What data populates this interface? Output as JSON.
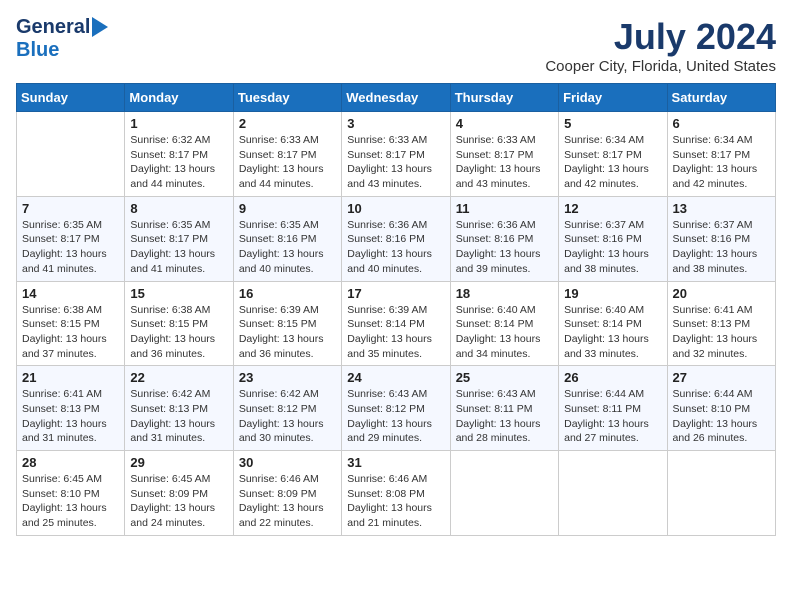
{
  "header": {
    "logo_general": "General",
    "logo_blue": "Blue",
    "month_year": "July 2024",
    "location": "Cooper City, Florida, United States"
  },
  "days_of_week": [
    "Sunday",
    "Monday",
    "Tuesday",
    "Wednesday",
    "Thursday",
    "Friday",
    "Saturday"
  ],
  "weeks": [
    [
      {
        "day": "",
        "sunrise": "",
        "sunset": "",
        "daylight": ""
      },
      {
        "day": "1",
        "sunrise": "Sunrise: 6:32 AM",
        "sunset": "Sunset: 8:17 PM",
        "daylight": "Daylight: 13 hours and 44 minutes."
      },
      {
        "day": "2",
        "sunrise": "Sunrise: 6:33 AM",
        "sunset": "Sunset: 8:17 PM",
        "daylight": "Daylight: 13 hours and 44 minutes."
      },
      {
        "day": "3",
        "sunrise": "Sunrise: 6:33 AM",
        "sunset": "Sunset: 8:17 PM",
        "daylight": "Daylight: 13 hours and 43 minutes."
      },
      {
        "day": "4",
        "sunrise": "Sunrise: 6:33 AM",
        "sunset": "Sunset: 8:17 PM",
        "daylight": "Daylight: 13 hours and 43 minutes."
      },
      {
        "day": "5",
        "sunrise": "Sunrise: 6:34 AM",
        "sunset": "Sunset: 8:17 PM",
        "daylight": "Daylight: 13 hours and 42 minutes."
      },
      {
        "day": "6",
        "sunrise": "Sunrise: 6:34 AM",
        "sunset": "Sunset: 8:17 PM",
        "daylight": "Daylight: 13 hours and 42 minutes."
      }
    ],
    [
      {
        "day": "7",
        "sunrise": "Sunrise: 6:35 AM",
        "sunset": "Sunset: 8:17 PM",
        "daylight": "Daylight: 13 hours and 41 minutes."
      },
      {
        "day": "8",
        "sunrise": "Sunrise: 6:35 AM",
        "sunset": "Sunset: 8:17 PM",
        "daylight": "Daylight: 13 hours and 41 minutes."
      },
      {
        "day": "9",
        "sunrise": "Sunrise: 6:35 AM",
        "sunset": "Sunset: 8:16 PM",
        "daylight": "Daylight: 13 hours and 40 minutes."
      },
      {
        "day": "10",
        "sunrise": "Sunrise: 6:36 AM",
        "sunset": "Sunset: 8:16 PM",
        "daylight": "Daylight: 13 hours and 40 minutes."
      },
      {
        "day": "11",
        "sunrise": "Sunrise: 6:36 AM",
        "sunset": "Sunset: 8:16 PM",
        "daylight": "Daylight: 13 hours and 39 minutes."
      },
      {
        "day": "12",
        "sunrise": "Sunrise: 6:37 AM",
        "sunset": "Sunset: 8:16 PM",
        "daylight": "Daylight: 13 hours and 38 minutes."
      },
      {
        "day": "13",
        "sunrise": "Sunrise: 6:37 AM",
        "sunset": "Sunset: 8:16 PM",
        "daylight": "Daylight: 13 hours and 38 minutes."
      }
    ],
    [
      {
        "day": "14",
        "sunrise": "Sunrise: 6:38 AM",
        "sunset": "Sunset: 8:15 PM",
        "daylight": "Daylight: 13 hours and 37 minutes."
      },
      {
        "day": "15",
        "sunrise": "Sunrise: 6:38 AM",
        "sunset": "Sunset: 8:15 PM",
        "daylight": "Daylight: 13 hours and 36 minutes."
      },
      {
        "day": "16",
        "sunrise": "Sunrise: 6:39 AM",
        "sunset": "Sunset: 8:15 PM",
        "daylight": "Daylight: 13 hours and 36 minutes."
      },
      {
        "day": "17",
        "sunrise": "Sunrise: 6:39 AM",
        "sunset": "Sunset: 8:14 PM",
        "daylight": "Daylight: 13 hours and 35 minutes."
      },
      {
        "day": "18",
        "sunrise": "Sunrise: 6:40 AM",
        "sunset": "Sunset: 8:14 PM",
        "daylight": "Daylight: 13 hours and 34 minutes."
      },
      {
        "day": "19",
        "sunrise": "Sunrise: 6:40 AM",
        "sunset": "Sunset: 8:14 PM",
        "daylight": "Daylight: 13 hours and 33 minutes."
      },
      {
        "day": "20",
        "sunrise": "Sunrise: 6:41 AM",
        "sunset": "Sunset: 8:13 PM",
        "daylight": "Daylight: 13 hours and 32 minutes."
      }
    ],
    [
      {
        "day": "21",
        "sunrise": "Sunrise: 6:41 AM",
        "sunset": "Sunset: 8:13 PM",
        "daylight": "Daylight: 13 hours and 31 minutes."
      },
      {
        "day": "22",
        "sunrise": "Sunrise: 6:42 AM",
        "sunset": "Sunset: 8:13 PM",
        "daylight": "Daylight: 13 hours and 31 minutes."
      },
      {
        "day": "23",
        "sunrise": "Sunrise: 6:42 AM",
        "sunset": "Sunset: 8:12 PM",
        "daylight": "Daylight: 13 hours and 30 minutes."
      },
      {
        "day": "24",
        "sunrise": "Sunrise: 6:43 AM",
        "sunset": "Sunset: 8:12 PM",
        "daylight": "Daylight: 13 hours and 29 minutes."
      },
      {
        "day": "25",
        "sunrise": "Sunrise: 6:43 AM",
        "sunset": "Sunset: 8:11 PM",
        "daylight": "Daylight: 13 hours and 28 minutes."
      },
      {
        "day": "26",
        "sunrise": "Sunrise: 6:44 AM",
        "sunset": "Sunset: 8:11 PM",
        "daylight": "Daylight: 13 hours and 27 minutes."
      },
      {
        "day": "27",
        "sunrise": "Sunrise: 6:44 AM",
        "sunset": "Sunset: 8:10 PM",
        "daylight": "Daylight: 13 hours and 26 minutes."
      }
    ],
    [
      {
        "day": "28",
        "sunrise": "Sunrise: 6:45 AM",
        "sunset": "Sunset: 8:10 PM",
        "daylight": "Daylight: 13 hours and 25 minutes."
      },
      {
        "day": "29",
        "sunrise": "Sunrise: 6:45 AM",
        "sunset": "Sunset: 8:09 PM",
        "daylight": "Daylight: 13 hours and 24 minutes."
      },
      {
        "day": "30",
        "sunrise": "Sunrise: 6:46 AM",
        "sunset": "Sunset: 8:09 PM",
        "daylight": "Daylight: 13 hours and 22 minutes."
      },
      {
        "day": "31",
        "sunrise": "Sunrise: 6:46 AM",
        "sunset": "Sunset: 8:08 PM",
        "daylight": "Daylight: 13 hours and 21 minutes."
      },
      {
        "day": "",
        "sunrise": "",
        "sunset": "",
        "daylight": ""
      },
      {
        "day": "",
        "sunrise": "",
        "sunset": "",
        "daylight": ""
      },
      {
        "day": "",
        "sunrise": "",
        "sunset": "",
        "daylight": ""
      }
    ]
  ]
}
